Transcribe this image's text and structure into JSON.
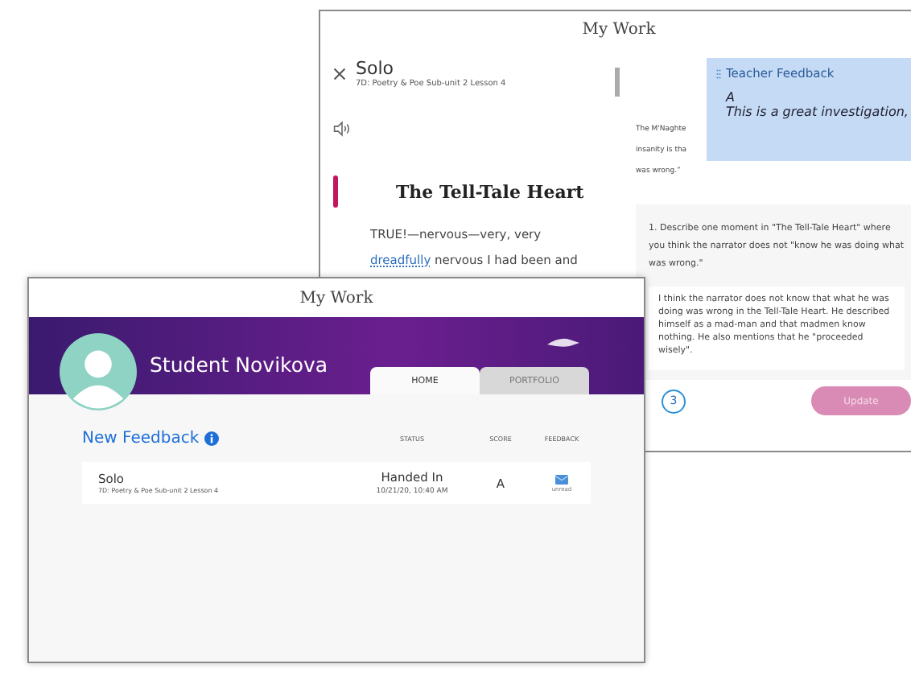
{
  "back_window": {
    "title": "My Work",
    "assignment": {
      "title": "Solo",
      "subtitle": "7D: Poetry & Poe Sub-unit 2 Lesson 4"
    },
    "reading": {
      "title": "The Tell-Tale Heart",
      "lines": [
        {
          "parts": [
            {
              "text": "TRUE!—nervous—very, very",
              "link": false
            }
          ]
        },
        {
          "parts": [
            {
              "text": "dreadfully",
              "link": true
            },
            {
              "text": " nervous I had been and",
              "link": false
            }
          ]
        }
      ]
    },
    "prompt_lines": [
      "The M'Naghte",
      "insanity is tha",
      "was wrong.”"
    ],
    "teacher_feedback": {
      "title": "Teacher Feedback",
      "score": "A",
      "comment": "This is a great investigation,"
    },
    "question": "1. Describe one moment in \"The Tell-Tale Heart\" where you think the narrator does not \"know he was doing what was wrong.\"",
    "answer": "I think the narrator does not know that what he was doing was wrong in the Tell-Tale Heart. He described himself as a mad-man and that madmen know nothing. He also mentions that he \"proceeded wisely\".",
    "step": "3",
    "update_button": {
      "label": "Update",
      "disabled": true
    }
  },
  "front_window": {
    "title": "My Work",
    "student_name": "Student Novikova",
    "tabs": [
      {
        "label": "HOME",
        "selected": true
      },
      {
        "label": "PORTFOLIO",
        "selected": false
      }
    ],
    "section_title": "New Feedback",
    "columns": [
      "STATUS",
      "SCORE",
      "FEEDBACK"
    ],
    "rows": [
      {
        "title": "Solo",
        "subtitle": "7D: Poetry & Poe Sub-unit 2 Lesson 4",
        "status": "Handed In",
        "date": "10/21/20, 10:40 AM",
        "score": "A",
        "feedback": "unread"
      }
    ]
  }
}
